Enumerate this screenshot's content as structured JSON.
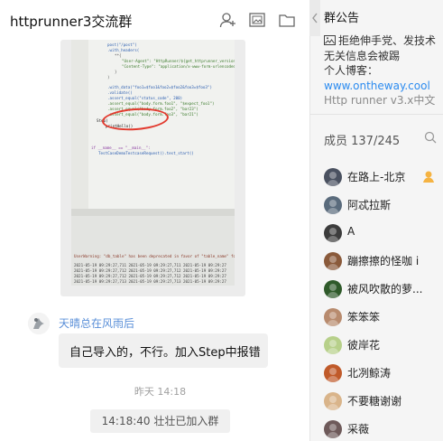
{
  "chat": {
    "title": "httprunner3交流群",
    "header_icons": [
      "add-member-icon",
      "image-window-icon",
      "folder-icon"
    ],
    "screenshot_code_lines": [
      "post(\"/post\")",
      ".with_headers(",
      "**{",
      "\"User-Agent\": \"HttpRunner/${get_httprunner_version}\",",
      "\"Content-Type\": \"application/x-www-form-urlencoded\",",
      "}",
      ")",
      ".with_data(\"foo1=$foo1&foo2=$foo2&foo3=$foo3\")",
      ".validate()",
      ".assert_equal(\"status_code\", 200)",
      ".assert_equal(\"body.form.foo1\", \"$expect_foo1\")",
      ".assert_equal(\"body.form.foo2\", \"bar23\")",
      ".assert_equal(\"body.form.foo3\", \"bar21\")",
      "Step(",
      "printHello()",
      "if __name__ == \"__main__\":",
      "TestCaseDemoTestcaseRequest().test_start()"
    ],
    "screenshot_terminal_lines": [
      "UserWarning: \"db_table\" has been deprecated in favor of \"table_name\" for Model.",
      "2021-05-19 09:29:27,711  2021-05-19 09:29:27,711  2021-05-19 09:29:27",
      "2021-05-19 09:29:27,712  2021-05-19 09:29:27,712  2021-05-19 09:29:27",
      "2021-05-19 09:29:27,712  2021-05-19 09:29:27,712  2021-05-19 09:29:27",
      "2021-05-19 09:29:27,713  2021-05-19 09:29:27,713  2021-05-19 09:29:27"
    ],
    "message": {
      "sender": "天晴总在风雨后",
      "text": "自己导入的，不行。加入Step中报错"
    },
    "time_separator": "昨天 14:18",
    "system_notice": "14:18:40 壮壮已加入群"
  },
  "side": {
    "notice_title": "群公告",
    "notice_line1": "拒绝伸手党、发技术无关信息会被踢",
    "notice_line2_prefix": "个人博客：",
    "notice_link": "www.ontheway.cool",
    "notice_faded": "Http runner v3.x中文文",
    "members_label": "成员 137/245",
    "members": [
      {
        "name": "在路上-北京",
        "owner": true,
        "color": "#4a5160"
      },
      {
        "name": "阿忒拉斯",
        "owner": false,
        "color": "#5a6b7c"
      },
      {
        "name": "A",
        "owner": false,
        "color": "#3c3c3c"
      },
      {
        "name": "蹦擦擦的怪咖 i",
        "owner": false,
        "color": "#8a5a3b"
      },
      {
        "name": "被风吹散的萝...",
        "owner": false,
        "color": "#2f5a2a"
      },
      {
        "name": "笨笨笨",
        "owner": false,
        "color": "#b88b6e"
      },
      {
        "name": "彼岸花",
        "owner": false,
        "color": "#b7d08a"
      },
      {
        "name": "北冽鲸涛",
        "owner": false,
        "color": "#c05a2a"
      },
      {
        "name": "不要糖谢谢",
        "owner": false,
        "color": "#d9b48a"
      },
      {
        "name": "采薇",
        "owner": false,
        "color": "#6e5a5a"
      }
    ]
  }
}
